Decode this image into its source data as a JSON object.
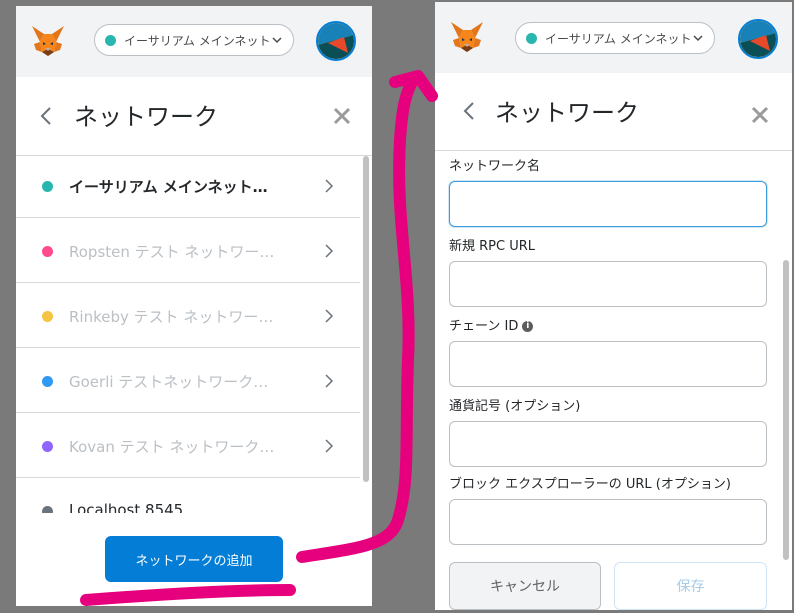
{
  "colors": {
    "accent": "#037dd6",
    "mainnet": "#29b6af",
    "ropsten": "#ff4a8d",
    "rinkeby": "#f6c343",
    "goerli": "#3099f2",
    "kovan": "#9064ff",
    "localhost": "#6a737d",
    "annotation": "#e6007e"
  },
  "header": {
    "network_name": "イーサリアム メインネット"
  },
  "settings": {
    "title": "ネットワーク"
  },
  "networks": [
    {
      "label": "イーサリアム メインネット…",
      "color": "#29b6af"
    },
    {
      "label": "Ropsten テスト ネットワー…",
      "color": "#ff4a8d"
    },
    {
      "label": "Rinkeby テスト ネットワー…",
      "color": "#f6c343"
    },
    {
      "label": "Goerli テストネットワーク…",
      "color": "#3099f2"
    },
    {
      "label": "Kovan テスト ネットワーク…",
      "color": "#9064ff"
    },
    {
      "label": "Localhost 8545",
      "color": "#6a737d"
    }
  ],
  "add_network_label": "ネットワークの追加",
  "form": {
    "network_name_label": "ネットワーク名",
    "rpc_url_label": "新規 RPC URL",
    "chain_id_label": "チェーン ID",
    "currency_symbol_label": "通貨記号 (オプション)",
    "explorer_url_label": "ブロック エクスプローラーの URL (オプション)",
    "cancel_label": "キャンセル",
    "save_label": "保存"
  }
}
